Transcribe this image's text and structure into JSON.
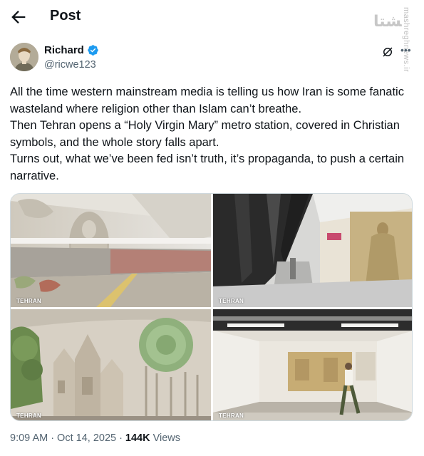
{
  "header": {
    "title": "Post"
  },
  "watermark": {
    "logo": "ﺸﺘﺎ",
    "text": "mashreghnews.ir"
  },
  "user": {
    "name": "Richard",
    "handle": "@ricwe123"
  },
  "post": {
    "text": "All the time western mainstream media is telling us how Iran is some fanatic wasteland where religion other than Islam can’t breathe.\nThen Tehran opens a “Holy Virgin Mary” metro station, covered in Christian symbols, and the whole story falls apart.\nTurns out, what we’ve been fed isn’t truth, it’s propaganda, to push a certain narrative."
  },
  "media": {
    "logo_text": "TEHRAN",
    "images": [
      {
        "alt": "platform-with-virgin-mary-relief"
      },
      {
        "alt": "escalators-and-relief-wall"
      },
      {
        "alt": "church-relief-and-green-rosette"
      },
      {
        "alt": "hall-with-man-walking"
      }
    ]
  },
  "meta": {
    "time": "9:09 AM",
    "separator": "·",
    "date": "Oct 14, 2025",
    "views_count": "144K",
    "views_label": "Views"
  },
  "colors": {
    "text": "#0f1419",
    "secondary": "#536471",
    "verified": "#1d9bf0",
    "border": "#cfd9de"
  }
}
